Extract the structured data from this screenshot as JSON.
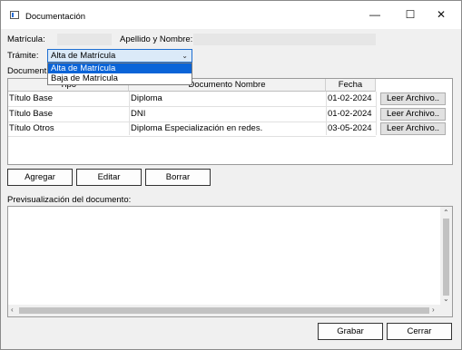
{
  "window": {
    "title": "Documentación",
    "minimize_glyph": "—",
    "maximize_glyph": "☐",
    "close_glyph": "✕"
  },
  "form": {
    "matricula_label": "Matrícula:",
    "apellido_label": "Apellido y Nombre:",
    "tramite_label": "Trámite:",
    "tramite_value": "Alta de Matrícula",
    "tramite_options": [
      "Alta de Matrícula",
      "Baja de Matrícula"
    ],
    "documentos_label": "Document"
  },
  "table": {
    "columns": [
      "Tipo",
      "Documento Nombre",
      "Fecha"
    ],
    "rows": [
      {
        "tipo": "Título Base",
        "nombre": "Diploma",
        "fecha": "01-02-2024",
        "action": "Leer Archivo.."
      },
      {
        "tipo": "Título Base",
        "nombre": "DNI",
        "fecha": "01-02-2024",
        "action": "Leer Archivo.."
      },
      {
        "tipo": "Título Otros",
        "nombre": "Diploma Especialización en redes.",
        "fecha": "03-05-2024",
        "action": "Leer Archivo.."
      }
    ]
  },
  "actions": {
    "agregar": "Agregar",
    "editar": "Editar",
    "borrar": "Borrar"
  },
  "preview": {
    "label": "Previsualización del documento:",
    "content": ""
  },
  "footer": {
    "grabar": "Grabar",
    "cerrar": "Cerrar"
  },
  "icons": [
    "app-icon",
    "minimize-icon",
    "maximize-icon",
    "close-icon",
    "chevron-down-icon",
    "scroll-up-icon",
    "scroll-down-icon",
    "scroll-left-icon",
    "scroll-right-icon"
  ]
}
